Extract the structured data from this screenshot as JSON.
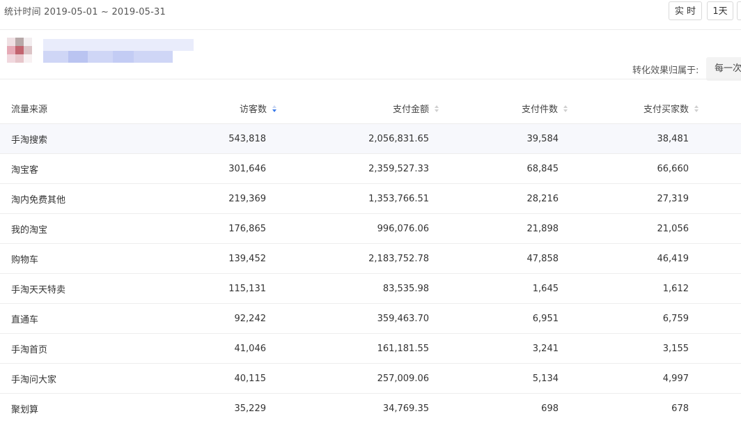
{
  "header": {
    "stat_time": "统计时间 2019-05-01 ~ 2019-05-31",
    "btn_realtime": "实 时",
    "btn_1day": "1天"
  },
  "attribution": {
    "label": "转化效果归属于:",
    "selected": "每一次"
  },
  "table": {
    "headers": {
      "source": "流量来源",
      "visitors": "访客数",
      "pay_amount": "支付金额",
      "pay_items": "支付件数",
      "pay_buyers": "支付买家数"
    },
    "rows": [
      {
        "source": "手淘搜索",
        "visitors": "543,818",
        "pay_amount": "2,056,831.65",
        "pay_items": "39,584",
        "pay_buyers": "38,481"
      },
      {
        "source": "淘宝客",
        "visitors": "301,646",
        "pay_amount": "2,359,527.33",
        "pay_items": "68,845",
        "pay_buyers": "66,660"
      },
      {
        "source": "淘内免费其他",
        "visitors": "219,369",
        "pay_amount": "1,353,766.51",
        "pay_items": "28,216",
        "pay_buyers": "27,319"
      },
      {
        "source": "我的淘宝",
        "visitors": "176,865",
        "pay_amount": "996,076.06",
        "pay_items": "21,898",
        "pay_buyers": "21,056"
      },
      {
        "source": "购物车",
        "visitors": "139,452",
        "pay_amount": "2,183,752.78",
        "pay_items": "47,858",
        "pay_buyers": "46,419"
      },
      {
        "source": "手淘天天特卖",
        "visitors": "115,131",
        "pay_amount": "83,535.98",
        "pay_items": "1,645",
        "pay_buyers": "1,612"
      },
      {
        "source": "直通车",
        "visitors": "92,242",
        "pay_amount": "359,463.70",
        "pay_items": "6,951",
        "pay_buyers": "6,759"
      },
      {
        "source": "手淘首页",
        "visitors": "41,046",
        "pay_amount": "161,181.55",
        "pay_items": "3,241",
        "pay_buyers": "3,155"
      },
      {
        "source": "手淘问大家",
        "visitors": "40,115",
        "pay_amount": "257,009.06",
        "pay_items": "5,134",
        "pay_buyers": "4,997"
      },
      {
        "source": "聚划算",
        "visitors": "35,229",
        "pay_amount": "34,769.35",
        "pay_items": "698",
        "pay_buyers": "678"
      }
    ]
  },
  "icons": {
    "sort_active": "sort-desc-icon",
    "sort_inactive": "sort-icon"
  },
  "colors": {
    "accent": "#3b7bea",
    "first_row_bg": "#f7f8fc"
  }
}
